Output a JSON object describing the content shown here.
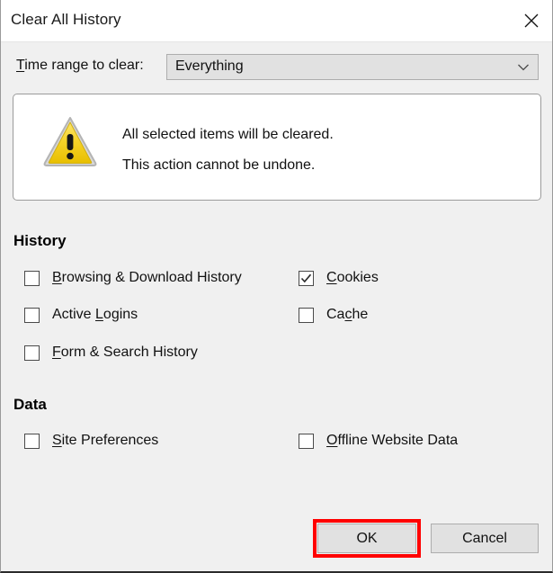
{
  "dialog": {
    "title": "Clear All History",
    "close_icon": "close-icon"
  },
  "timerange": {
    "label_before": "T",
    "label_after": "ime range to clear:",
    "selected_value": "Everything",
    "arrow_icon": "chevron-down-icon"
  },
  "warning": {
    "icon": "warning-triangle-icon",
    "line1": "All selected items will be cleared.",
    "line2": "This action cannot be undone."
  },
  "sections": {
    "history": {
      "heading": "History",
      "items": [
        {
          "accel": "B",
          "rest": "rowsing & Download History",
          "checked": false,
          "name": "browsing-download-history"
        },
        {
          "accel": "",
          "rest": "",
          "checked": true,
          "name": "cookies"
        },
        {
          "accel": "",
          "rest": "",
          "checked": false,
          "name": "active-logins"
        },
        {
          "accel": "",
          "rest": "",
          "checked": false,
          "name": "cache"
        },
        {
          "accel": "F",
          "rest": "orm & Search History",
          "checked": false,
          "name": "form-search-history"
        }
      ],
      "cookies_pre": "",
      "cookies_accel": "C",
      "cookies_rest": "ookies",
      "active_logins_pre": "Active ",
      "active_logins_accel": "L",
      "active_logins_rest": "ogins",
      "cache_pre": "Ca",
      "cache_accel": "c",
      "cache_rest": "he",
      "form_accel": "F",
      "form_rest": "orm & Search History",
      "browsing_accel": "B",
      "browsing_rest": "rowsing & Download History"
    },
    "data": {
      "heading": "Data",
      "site_prefs_accel": "S",
      "site_prefs_rest": "ite Preferences",
      "offline_accel": "O",
      "offline_rest": "ffline Website Data"
    }
  },
  "footer": {
    "ok_label": "OK",
    "cancel_label": "Cancel"
  },
  "colors": {
    "highlight": "#ff0000",
    "dialog_bg": "#f0f0f0",
    "warning_yellow": "#f2cb1a"
  }
}
